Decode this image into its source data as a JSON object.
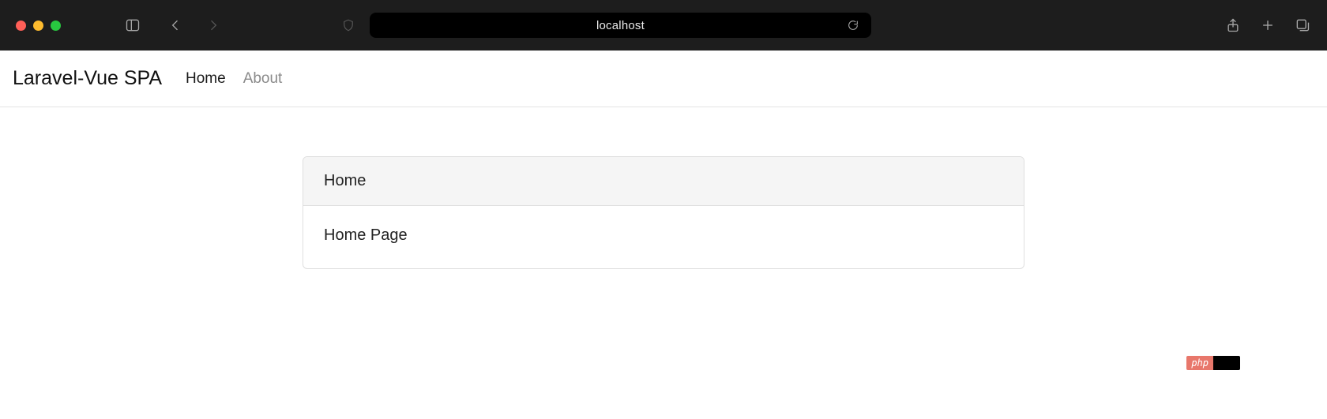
{
  "browser": {
    "url": "localhost"
  },
  "navbar": {
    "brand": "Laravel-Vue SPA",
    "links": {
      "home": "Home",
      "about": "About"
    }
  },
  "card": {
    "title": "Home",
    "body": "Home Page"
  },
  "watermark": {
    "label": "php"
  }
}
